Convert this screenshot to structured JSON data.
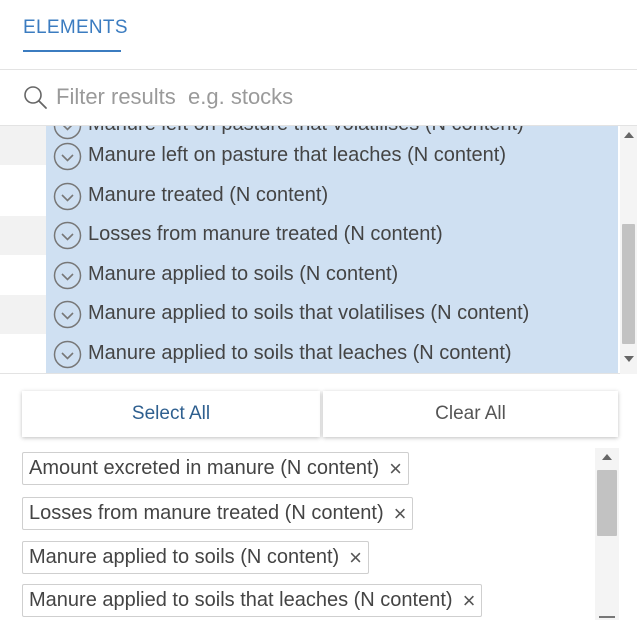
{
  "tabs": {
    "active_label": "ELEMENTS"
  },
  "filter": {
    "placeholder": "Filter results  e.g. stocks",
    "value": ""
  },
  "results": {
    "partial_top_label": "Manure left on pasture that volatilises (N content)",
    "items": [
      {
        "label": "Manure left on pasture that leaches (N content)",
        "selected": true
      },
      {
        "label": "Manure treated (N content)",
        "selected": true
      },
      {
        "label": "Losses from manure treated (N content)",
        "selected": true
      },
      {
        "label": "Manure applied to soils (N content)",
        "selected": true
      },
      {
        "label": "Manure applied to soils that volatilises (N content)",
        "selected": true
      },
      {
        "label": "Manure applied to soils that leaches (N content)",
        "selected": true
      }
    ]
  },
  "actions": {
    "select_all": "Select All",
    "clear_all": "Clear All"
  },
  "chips": [
    {
      "label": "Amount excreted in manure (N content)",
      "remove": "×"
    },
    {
      "label": "Losses from manure treated (N content)",
      "remove": "×"
    },
    {
      "label": "Manure applied to soils (N content)",
      "remove": "×"
    },
    {
      "label": "Manure applied to soils that leaches (N content)",
      "remove": "×"
    }
  ],
  "colors": {
    "accent": "#3b7cc0",
    "selected_bg": "#cfe0f2",
    "stripe": "#f2f2f2"
  },
  "icons": {
    "search": "search-icon",
    "check": "check-circle-icon",
    "remove": "close-icon"
  }
}
